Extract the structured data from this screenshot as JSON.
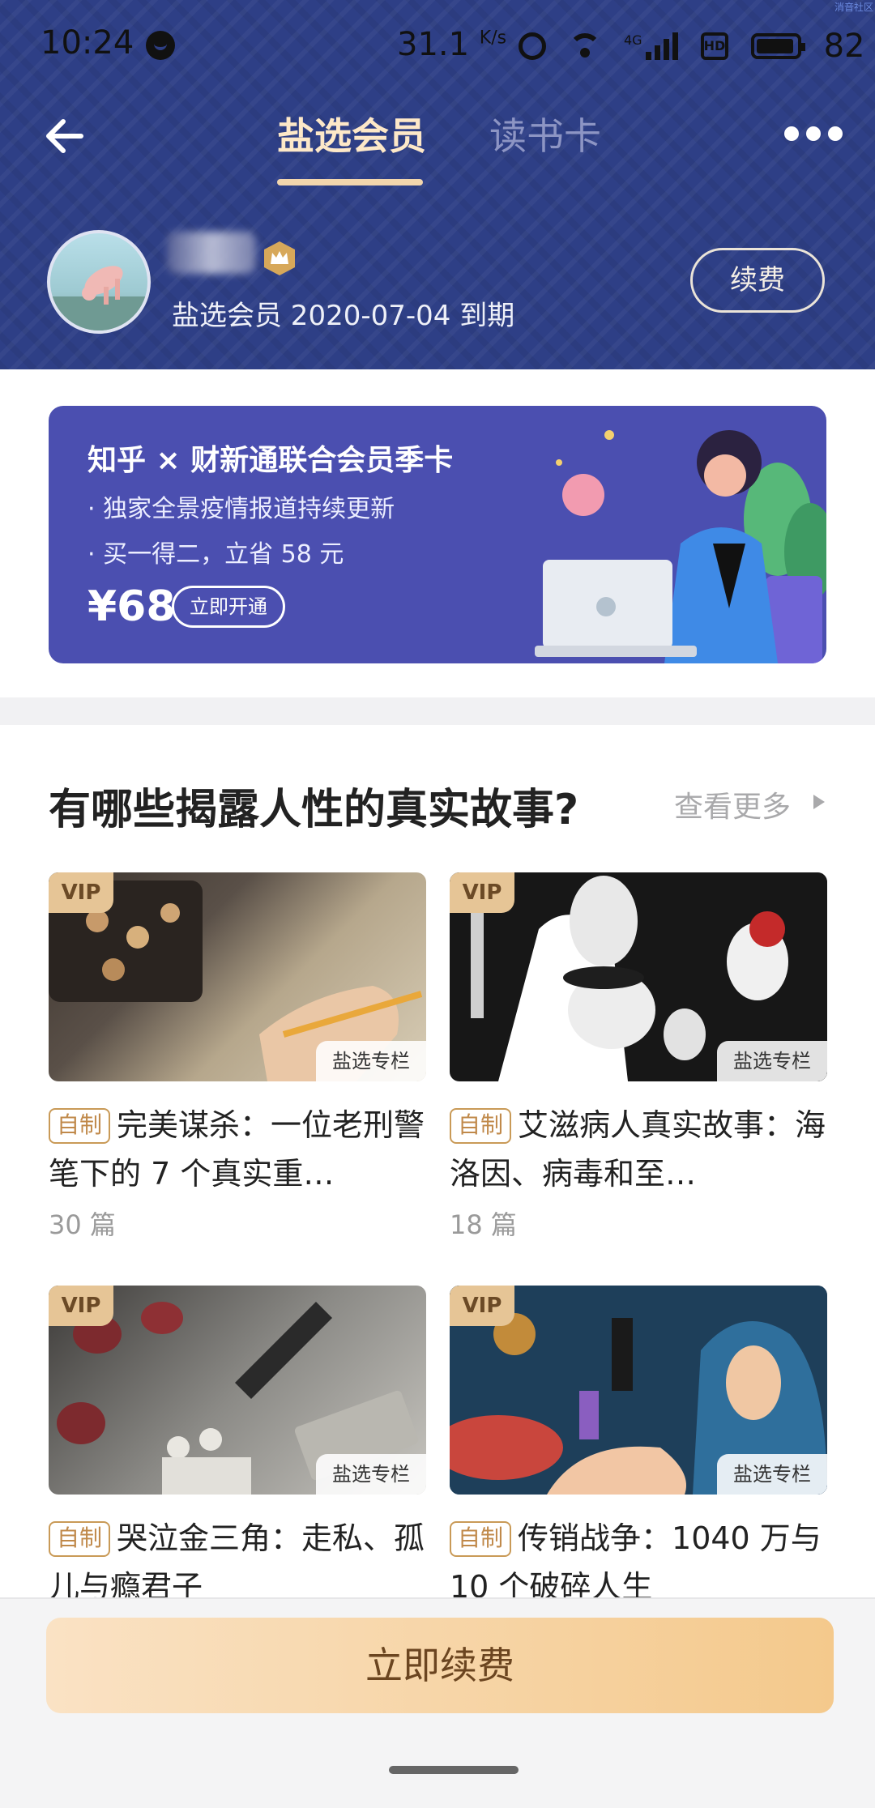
{
  "status_bar": {
    "time": "10:24",
    "speed": "31.1",
    "speed_unit": "K/s",
    "network": "4G",
    "hd": "HD",
    "battery": "82",
    "corner_mark": "消音社区"
  },
  "nav": {
    "tabs": [
      {
        "label": "盐选会员",
        "active": true
      },
      {
        "label": "读书卡",
        "active": false
      }
    ]
  },
  "profile": {
    "expire_text": "盐选会员 2020-07-04 到期",
    "renew_label": "续费"
  },
  "banner": {
    "title": "知乎 × 财新通联合会员季卡",
    "line1": "· 独家全景疫情报道持续更新",
    "line2": "· 买一得二，立省 58 元",
    "price": "¥68",
    "cta": "立即开通"
  },
  "section": {
    "title": "有哪些揭露人性的真实故事?",
    "see_more": "查看更多"
  },
  "cards": [
    {
      "vip": "VIP",
      "column_tag": "盐选专栏",
      "self_tag": "自制",
      "title": "完美谋杀：一位老刑警笔下的 7 个真实重…",
      "count": "30 篇"
    },
    {
      "vip": "VIP",
      "column_tag": "盐选专栏",
      "self_tag": "自制",
      "title": "艾滋病人真实故事：海洛因、病毒和至…",
      "count": "18 篇"
    },
    {
      "vip": "VIP",
      "column_tag": "盐选专栏",
      "self_tag": "自制",
      "title": "哭泣金三角：走私、孤儿与瘾君子",
      "count": ""
    },
    {
      "vip": "VIP",
      "column_tag": "盐选专栏",
      "self_tag": "自制",
      "title": "传销战争：1040 万与 10 个破碎人生",
      "count": ""
    }
  ],
  "bottom": {
    "renew_button": "立即续费"
  },
  "colors": {
    "header_bg": "#2e3f86",
    "active_tab": "#fde8c8",
    "banner_bg": "#4b4fb0",
    "gold_button_start": "#fae2c4",
    "gold_button_end": "#f4c98c"
  }
}
